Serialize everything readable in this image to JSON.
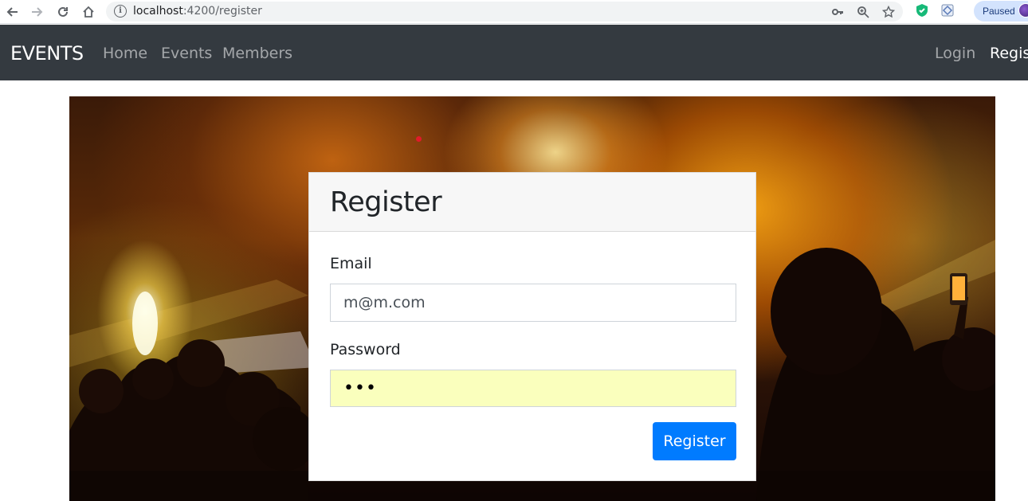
{
  "browser": {
    "url_host": "localhost",
    "url_path": ":4200/register",
    "paused_label": "Paused"
  },
  "navbar": {
    "brand": "EVENTS",
    "links": [
      {
        "label": "Home"
      },
      {
        "label": "Events"
      },
      {
        "label": "Members"
      }
    ],
    "right_links": [
      {
        "label": "Login"
      },
      {
        "label": "Register"
      }
    ]
  },
  "register_card": {
    "title": "Register",
    "email_label": "Email",
    "email_value": "m@m.com",
    "password_label": "Password",
    "password_masked": "•••",
    "submit_label": "Register"
  },
  "colors": {
    "navbar_bg": "#343a40",
    "primary": "#007bff",
    "autofill": "#faffbd"
  }
}
